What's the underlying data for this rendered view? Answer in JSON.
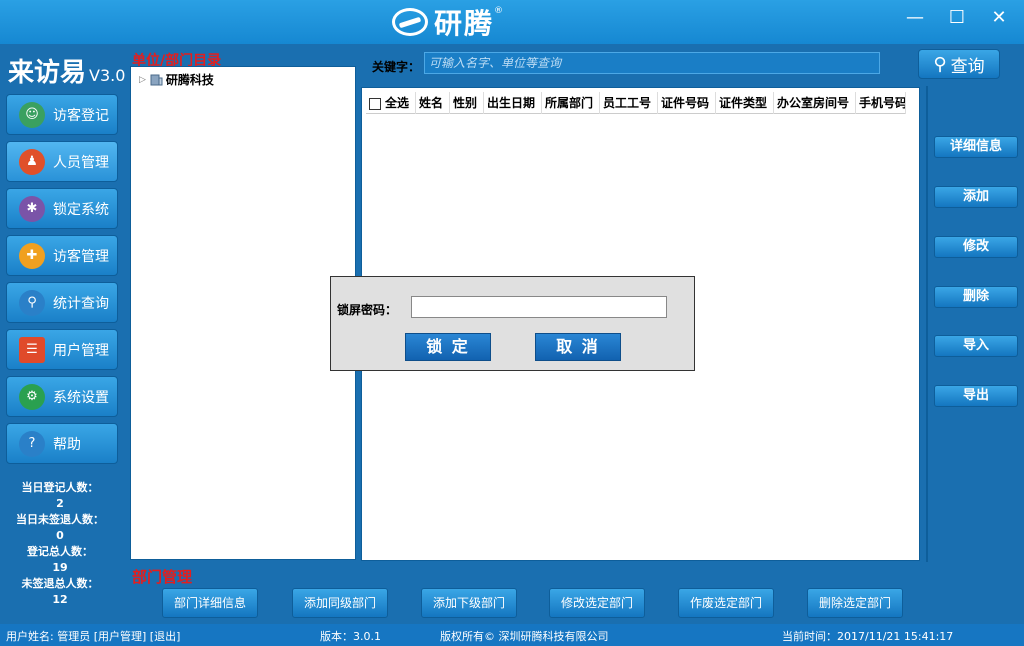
{
  "title_bar": {
    "logo_text": "研腾",
    "logo_reg": "®",
    "minimize": "—",
    "maximize": "☐",
    "close": "✕"
  },
  "app": {
    "name": "来访易",
    "version": "V3.0"
  },
  "sidebar": {
    "items": [
      {
        "label": "访客登记",
        "icon": "visitor-register-icon",
        "color": "#3aa060"
      },
      {
        "label": "人员管理",
        "icon": "person-shirt-icon",
        "color": "#e0502a"
      },
      {
        "label": "锁定系统",
        "icon": "bug-lock-icon",
        "color": "#7a54a8"
      },
      {
        "label": "访客管理",
        "icon": "visitor-add-icon",
        "color": "#f0a020"
      },
      {
        "label": "统计查询",
        "icon": "magnifier-icon",
        "color": "#2a80c8"
      },
      {
        "label": "用户管理",
        "icon": "document-list-icon",
        "color": "#e04a2a"
      },
      {
        "label": "系统设置",
        "icon": "gear-icon",
        "color": "#2aa050"
      },
      {
        "label": "帮助",
        "icon": "help-icon",
        "color": "#2a80c8"
      }
    ],
    "stats": [
      {
        "label": "当日登记人数：",
        "value": "2"
      },
      {
        "label": "当日未签退人数：",
        "value": "0"
      },
      {
        "label": "登记总人数：",
        "value": "19"
      },
      {
        "label": "未签退总人数：",
        "value": "12"
      }
    ]
  },
  "tree": {
    "title": "单位/部门目录",
    "root": "研腾科技"
  },
  "search": {
    "label": "关键字：",
    "placeholder": "可输入名字、单位等查询",
    "button": "查询"
  },
  "table": {
    "headers": [
      "全选",
      "姓名",
      "性别",
      "出生日期",
      "所属部门",
      "员工工号",
      "证件号码",
      "证件类型",
      "办公室房间号",
      "手机号码"
    ]
  },
  "actions": [
    "详细信息",
    "添加",
    "修改",
    "删除",
    "导入",
    "导出"
  ],
  "dialog": {
    "label": "锁屏密码：",
    "value": "",
    "ok": "锁 定",
    "cancel": "取 消"
  },
  "dept": {
    "title": "部门管理",
    "buttons": [
      "部门详细信息",
      "添加同级部门",
      "添加下级部门",
      "修改选定部门",
      "作废选定部门",
      "删除选定部门"
    ]
  },
  "status": {
    "user": "用户姓名: 管理员 [用户管理] [退出]",
    "version": "版本：3.0.1",
    "copyright": "版权所有© 深圳研腾科技有限公司",
    "time": "当前时间：2017/11/21 15:41:17"
  },
  "colors": {
    "accent": "#1a6fb0",
    "title_red": "#e31e1e"
  }
}
